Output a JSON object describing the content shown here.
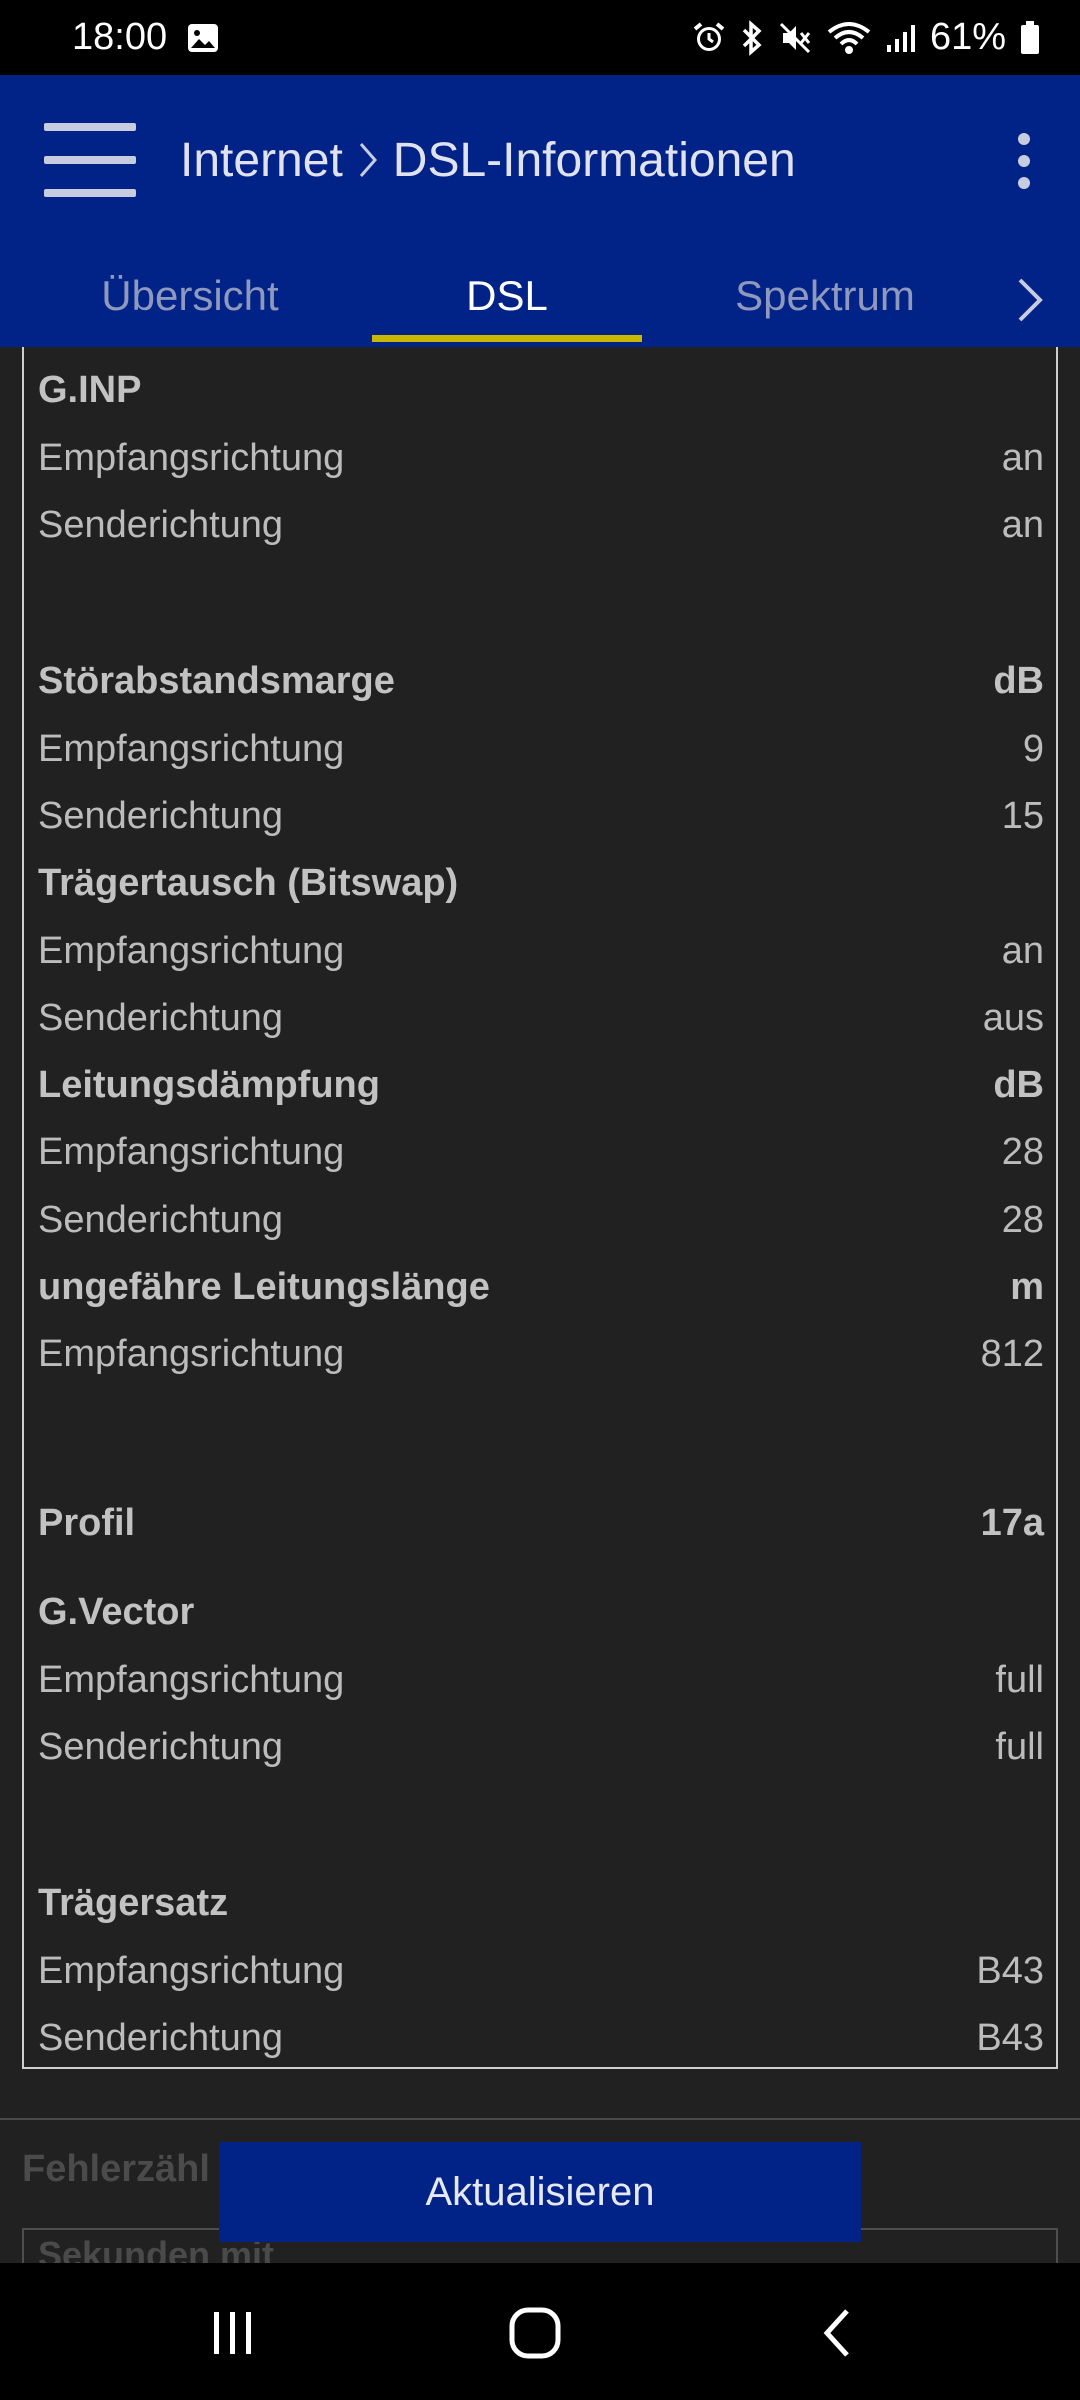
{
  "status_bar": {
    "time": "18:00",
    "battery": "61%"
  },
  "app_bar": {
    "breadcrumb_root": "Internet",
    "breadcrumb_current": "DSL-Informationen"
  },
  "tabs": [
    {
      "label": "Übersicht"
    },
    {
      "label": "DSL"
    },
    {
      "label": "Spektrum"
    }
  ],
  "colors": {
    "accent": "#012387",
    "tab_indicator": "#c9b800",
    "background": "#212121"
  },
  "dsl": {
    "ginp": {
      "label": "G.INP",
      "down_label": "Empfangsrichtung",
      "down": "an",
      "up_label": "Senderichtung",
      "up": "an"
    },
    "snr": {
      "label": "Störabstandsmarge",
      "unit": "dB",
      "down_label": "Empfangsrichtung",
      "down": "9",
      "up_label": "Senderichtung",
      "up": "15"
    },
    "bitswap": {
      "label": "Trägertausch (Bitswap)",
      "down_label": "Empfangsrichtung",
      "down": "an",
      "up_label": "Senderichtung",
      "up": "aus"
    },
    "attenuation": {
      "label": "Leitungsdämpfung",
      "unit": "dB",
      "down_label": "Empfangsrichtung",
      "down": "28",
      "up_label": "Senderichtung",
      "up": "28"
    },
    "length": {
      "label": "ungefähre Leitungslänge",
      "unit": "m",
      "down_label": "Empfangsrichtung",
      "down": "812"
    },
    "profile": {
      "label": "Profil",
      "value": "17a"
    },
    "gvector": {
      "label": "G.Vector",
      "down_label": "Empfangsrichtung",
      "down": "full",
      "up_label": "Senderichtung",
      "up": "full"
    },
    "carrier": {
      "label": "Trägersatz",
      "down_label": "Empfangsrichtung",
      "down": "B43",
      "up_label": "Senderichtung",
      "up": "B43"
    }
  },
  "under": {
    "section_label": "Fehlerzähl",
    "box_label": "Sekunden mit"
  },
  "refresh_label": "Aktualisieren"
}
